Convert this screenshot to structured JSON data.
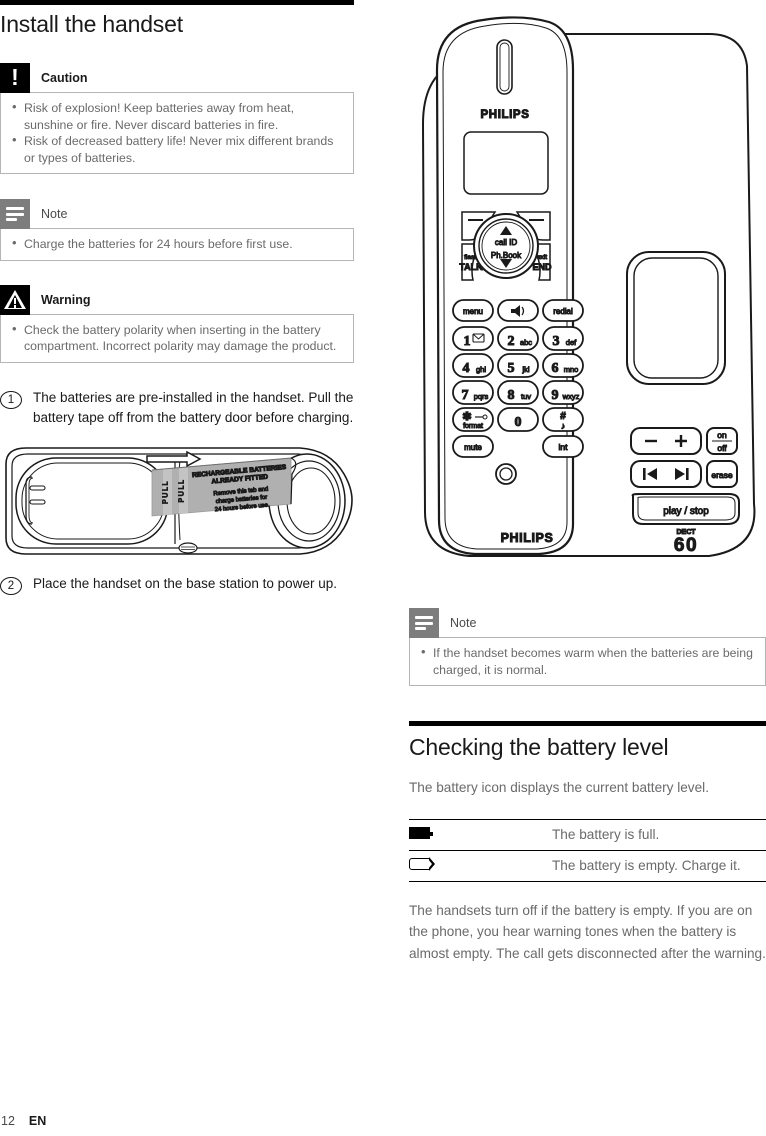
{
  "page": {
    "number": "12",
    "language": "EN"
  },
  "left": {
    "title": "Install the handset",
    "caution": {
      "icon": "caution-icon",
      "glyph": "!",
      "label": "Caution",
      "items": [
        "Risk of explosion! Keep batteries away from heat, sunshine or fire. Never discard batteries in fire.",
        "Risk of decreased battery life! Never mix different brands or types of batteries."
      ]
    },
    "note": {
      "icon": "note-icon",
      "label": "Note",
      "items": [
        "Charge the batteries for 24 hours before first use."
      ]
    },
    "warning": {
      "icon": "warning-icon",
      "label": "Warning",
      "items": [
        "Check the battery polarity when inserting in the battery compartment. Incorrect polarity may damage the product."
      ]
    },
    "steps": [
      {
        "number": "1",
        "text": "The batteries are pre-installed in the handset. Pull the battery tape off from the battery door before charging."
      },
      {
        "number": "2",
        "text": "Place the handset on the base station to power up."
      }
    ],
    "illustration": {
      "name": "handset-battery-door-illustration",
      "tab_title": "RECHARGEABLE BATTERIES ALREADY FITTED",
      "tab_body": "Remove this tab and charge batteries for 24 hours before use.",
      "pull_label_left": "PULL",
      "pull_label_right": "PULL"
    }
  },
  "right": {
    "illustration": {
      "name": "philips-dect-phone-illustration",
      "brand_top": "PHILIPS",
      "brand_bottom": "PHILIPS",
      "model_prefix": "DECT",
      "model_number": "60",
      "nav": {
        "up_label": "call ID",
        "down_label": "Ph.Book",
        "left_soft": "—",
        "right_soft": "—",
        "talk_top": "flash",
        "talk_bottom": "TALK",
        "end_top": "exit",
        "end_bottom": "END"
      },
      "function_keys": [
        {
          "label": "menu"
        },
        {
          "label": "speaker"
        },
        {
          "label": "redial"
        }
      ],
      "keypad": [
        {
          "digit": "1",
          "letters": "✉"
        },
        {
          "digit": "2",
          "letters": "abc"
        },
        {
          "digit": "3",
          "letters": "def"
        },
        {
          "digit": "4",
          "letters": "ghi"
        },
        {
          "digit": "5",
          "letters": "jkl"
        },
        {
          "digit": "6",
          "letters": "mno"
        },
        {
          "digit": "7",
          "letters": "pqrs"
        },
        {
          "digit": "8",
          "letters": "tuv"
        },
        {
          "digit": "9",
          "letters": "wxyz"
        },
        {
          "digit": "✱",
          "letters": "format"
        },
        {
          "digit": "0",
          "letters": ""
        },
        {
          "digit": "#",
          "letters": "♪"
        }
      ],
      "bottom_keys": [
        {
          "label": "mute"
        },
        {
          "label": "int"
        }
      ],
      "base_keys": {
        "volume_minus": "−",
        "volume_plus": "+",
        "on_off_top": "on",
        "on_off_bottom": "off",
        "prev": "⏮",
        "next": "⏭",
        "erase": "erase",
        "play_stop": "play / stop"
      }
    },
    "note": {
      "icon": "note-icon",
      "label": "Note",
      "items": [
        "If the handset becomes warm when the batteries are being charged, it is normal."
      ]
    },
    "section": {
      "title": "Checking the battery level",
      "intro": "The battery icon displays the current battery level.",
      "table": {
        "rows": [
          {
            "icon": "battery-full-icon",
            "description": "The battery is full."
          },
          {
            "icon": "battery-empty-icon",
            "description": "The battery is empty. Charge it."
          }
        ]
      },
      "outro": "The handsets turn off if the battery is empty. If you are on the phone, you hear warning tones when the battery is almost empty. The call gets disconnected after the warning."
    }
  }
}
